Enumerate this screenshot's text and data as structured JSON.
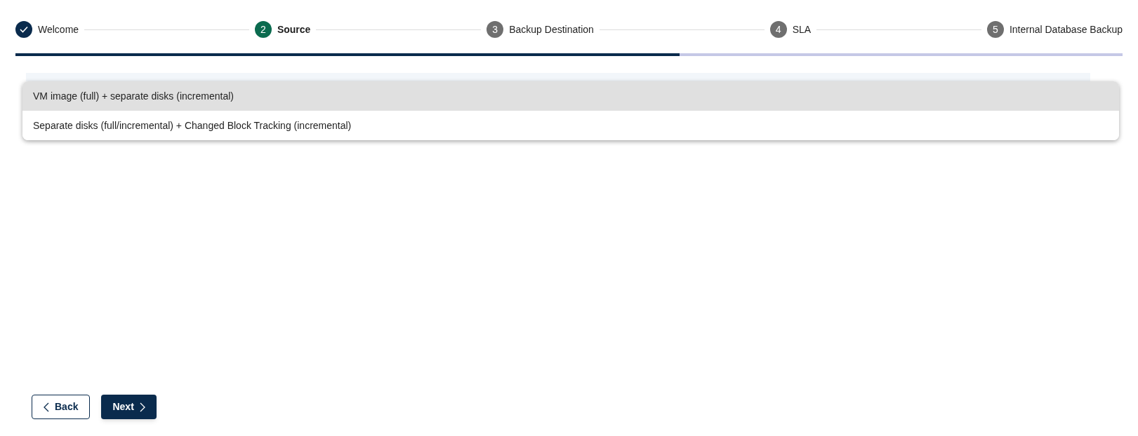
{
  "steps": [
    {
      "kind": "done",
      "label": "Welcome"
    },
    {
      "kind": "current",
      "number": "2",
      "label": "Source"
    },
    {
      "kind": "upcoming",
      "number": "3",
      "label": "Backup Destination"
    },
    {
      "kind": "upcoming",
      "number": "4",
      "label": "SLA"
    },
    {
      "kind": "upcoming",
      "number": "5",
      "label": "Internal Database Backup"
    }
  ],
  "progress": {
    "level": 0.6
  },
  "dropdown": {
    "options": [
      {
        "label": "VM image (full) + separate disks (incremental)",
        "selected": true
      },
      {
        "label": "Separate disks (full/incremental) + Changed Block Tracking (incremental)",
        "selected": false
      }
    ]
  },
  "buttons": {
    "back": "Back",
    "next": "Next"
  }
}
